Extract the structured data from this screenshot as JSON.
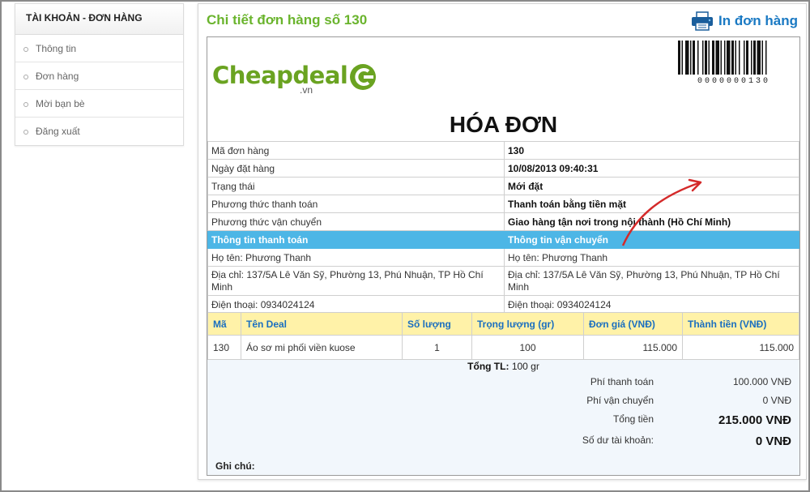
{
  "sidebar": {
    "title": "TÀI KHOẢN - ĐƠN HÀNG",
    "items": [
      {
        "label": "Thông tin"
      },
      {
        "label": "Đơn hàng"
      },
      {
        "label": "Mời bạn bè"
      },
      {
        "label": "Đăng xuất"
      }
    ]
  },
  "header": {
    "title": "Chi tiết đơn hàng số 130",
    "print_label": "In đơn hàng"
  },
  "logo": {
    "text": "Cheapdeal",
    "suffix": ".vn"
  },
  "barcode": {
    "number": "0000000130"
  },
  "invoice": {
    "title": "HÓA ĐƠN",
    "rows": [
      {
        "label": "Mã đơn hàng",
        "value": "130"
      },
      {
        "label": "Ngày đặt hàng",
        "value": "10/08/2013 09:40:31"
      },
      {
        "label": "Trạng thái",
        "value": "Mới đặt"
      },
      {
        "label": "Phương thức thanh toán",
        "value": "Thanh toán bằng tiền mặt"
      },
      {
        "label": "Phương thức vận chuyển",
        "value": "Giao hàng tận nơi trong nội thành (Hồ Chí Minh)"
      }
    ],
    "payment_header": "Thông tin thanh toán",
    "shipping_header": "Thông tin vận chuyển",
    "payment": {
      "name": "Họ tên: Phương Thanh",
      "address": "Địa chỉ: 137/5A Lê Văn Sỹ, Phường 13, Phú Nhuận, TP Hồ Chí Minh",
      "phone": "Điện thoại: 0934024124"
    },
    "shipping": {
      "name": "Họ tên: Phương Thanh",
      "address": "Địa chỉ: 137/5A Lê Văn Sỹ, Phường 13, Phú Nhuận, TP Hồ Chí Minh",
      "phone": "Điện thoại: 0934024124"
    }
  },
  "items": {
    "headers": [
      "Mã",
      "Tên Deal",
      "Số lượng",
      "Trọng lượng (gr)",
      "Đơn giá (VNĐ)",
      "Thành tiền (VNĐ)"
    ],
    "rows": [
      {
        "code": "130",
        "name": "Áo sơ mi phối viền kuose",
        "qty": "1",
        "weight": "100",
        "unit_price": "115.000",
        "total": "115.000"
      }
    ]
  },
  "totals": {
    "weight_label": "Tổng TL:",
    "weight_value": "100 gr",
    "payment_fee_label": "Phí thanh toán",
    "payment_fee": "100.000 VNĐ",
    "shipping_fee_label": "Phí vận chuyển",
    "shipping_fee": "0 VNĐ",
    "total_label": "Tổng tiền",
    "total": "215.000 VNĐ",
    "balance_label": "Số dư tài khoản:",
    "balance": "0 VNĐ"
  },
  "note_label": "Ghi chú:",
  "colors": {
    "title_green": "#6ab42d",
    "print_blue": "#1a79c3",
    "section_header": "#4db6e6",
    "items_header_bg": "#fff2a8",
    "arrow_red": "#d42a2a"
  }
}
